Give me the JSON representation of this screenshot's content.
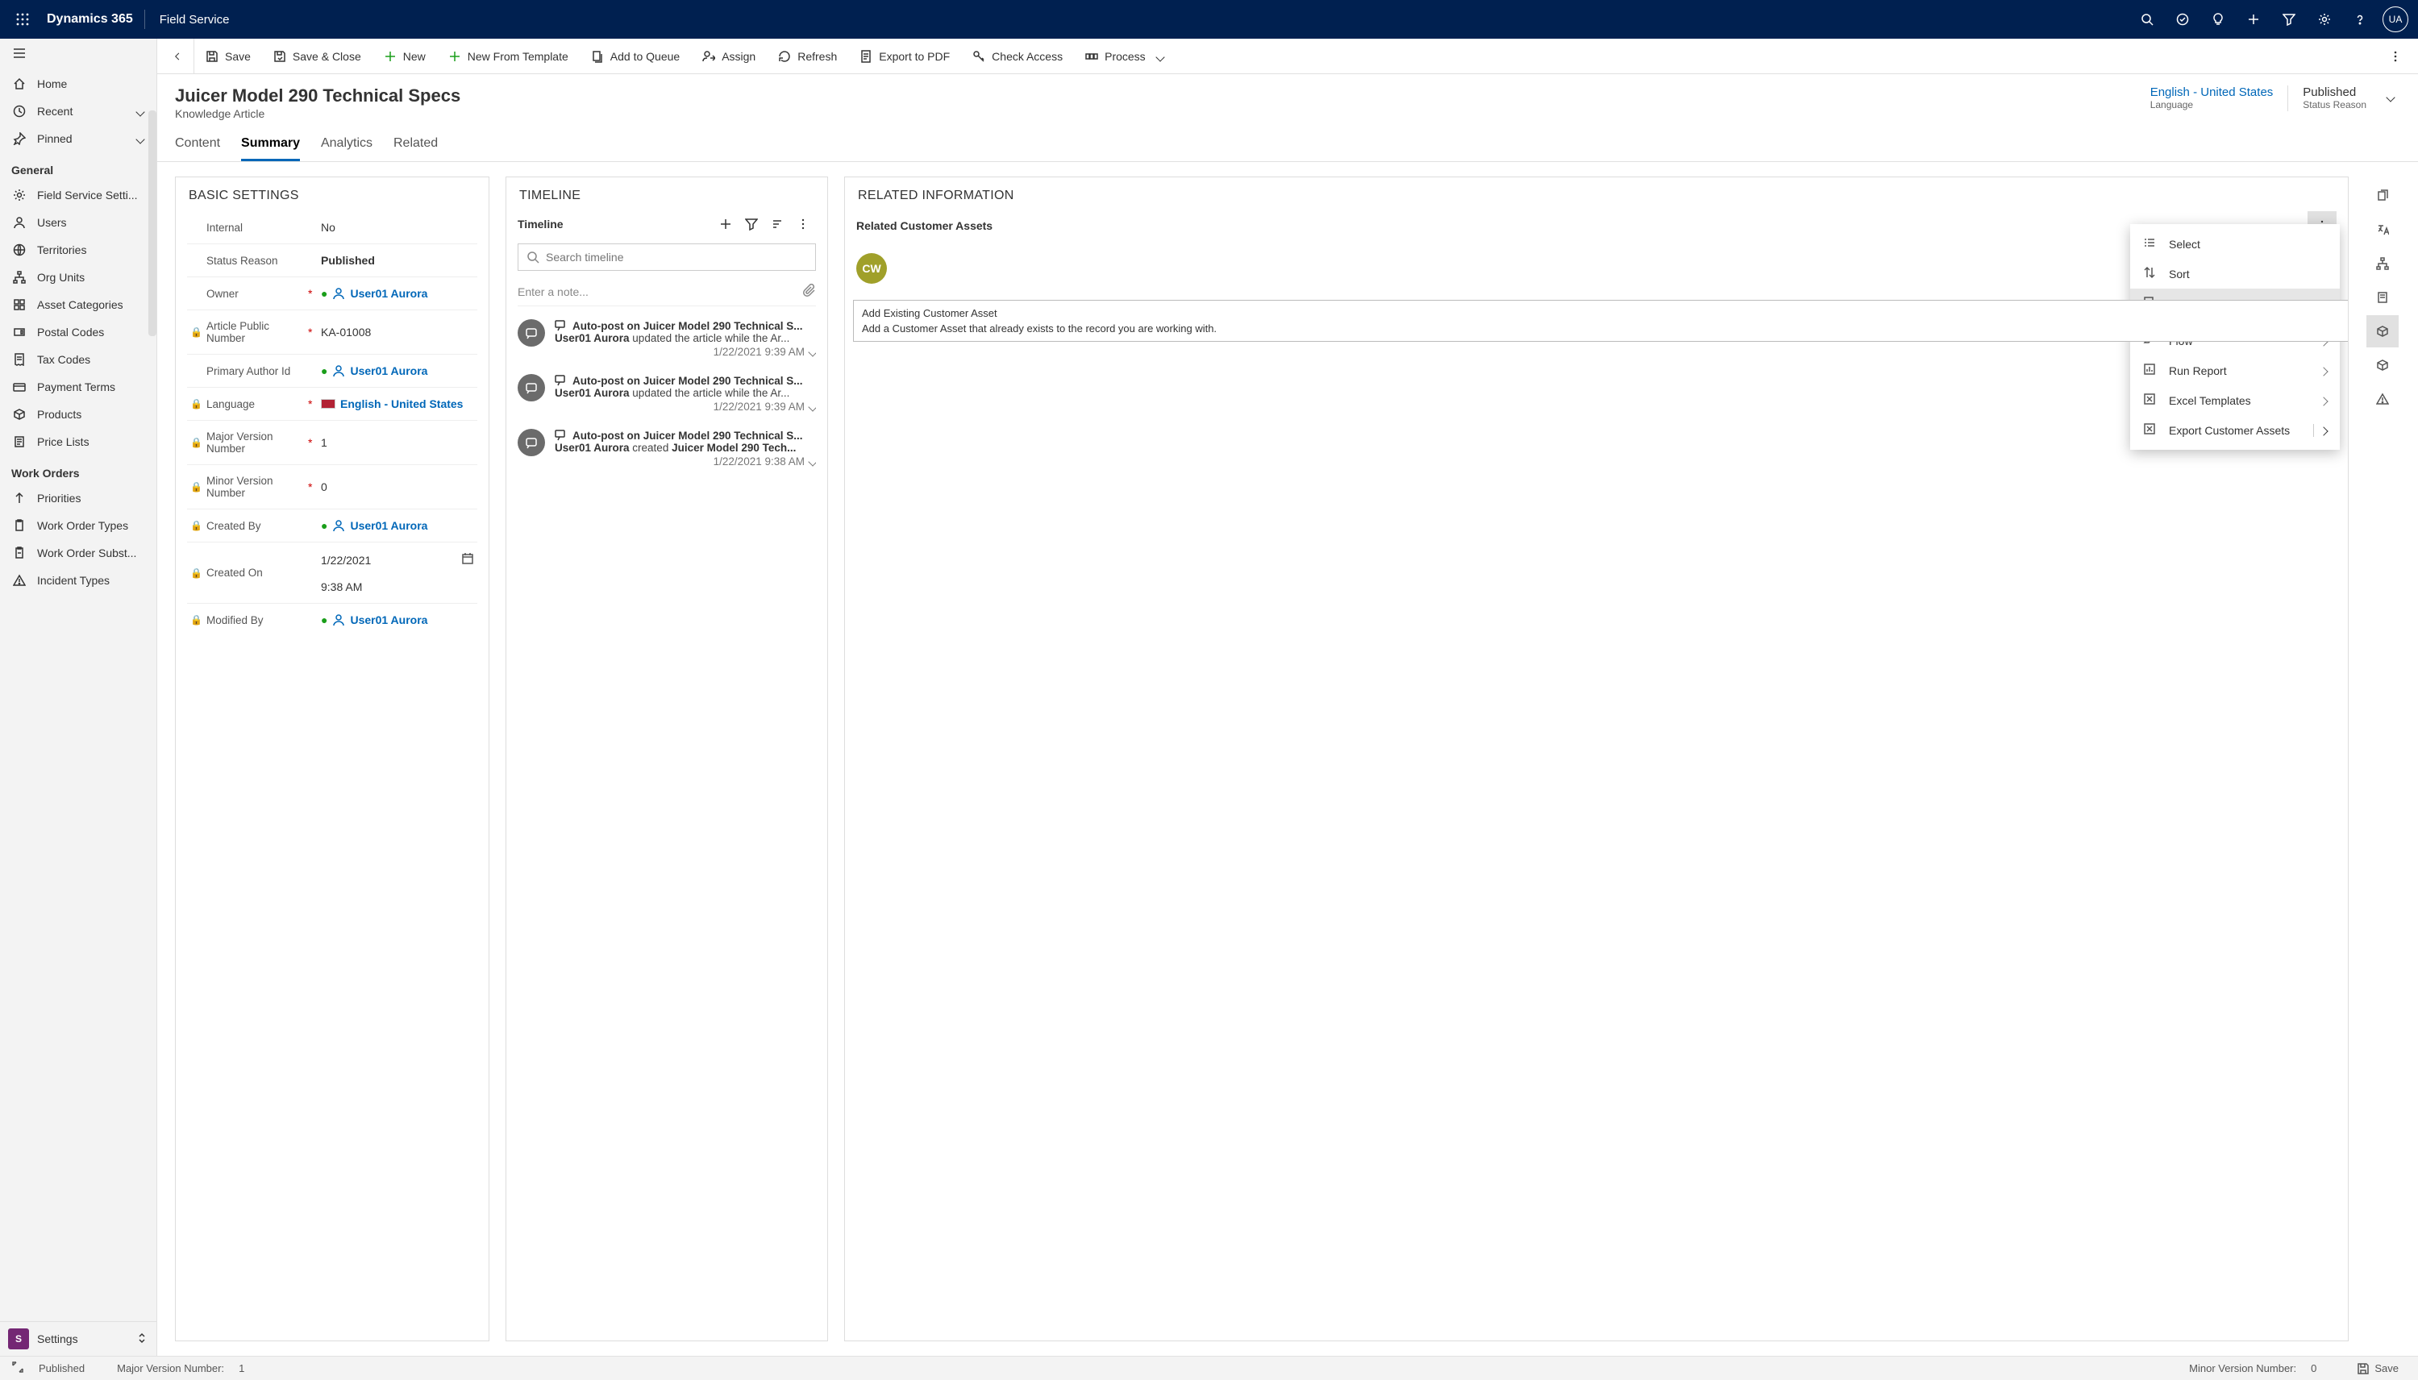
{
  "header": {
    "brand": "Dynamics 365",
    "module": "Field Service",
    "avatar": "UA"
  },
  "sidebar": {
    "top": [
      {
        "icon": "home",
        "label": "Home"
      },
      {
        "icon": "recent",
        "label": "Recent",
        "chevron": true
      },
      {
        "icon": "pin",
        "label": "Pinned",
        "chevron": true
      }
    ],
    "sections": [
      {
        "title": "General",
        "items": [
          {
            "icon": "gear",
            "label": "Field Service Setti..."
          },
          {
            "icon": "user",
            "label": "Users"
          },
          {
            "icon": "globe",
            "label": "Territories"
          },
          {
            "icon": "org",
            "label": "Org Units"
          },
          {
            "icon": "assetcat",
            "label": "Asset Categories"
          },
          {
            "icon": "postal",
            "label": "Postal Codes"
          },
          {
            "icon": "tax",
            "label": "Tax Codes"
          },
          {
            "icon": "payment",
            "label": "Payment Terms"
          },
          {
            "icon": "product",
            "label": "Products"
          },
          {
            "icon": "pricelist",
            "label": "Price Lists"
          }
        ]
      },
      {
        "title": "Work Orders",
        "items": [
          {
            "icon": "priority",
            "label": "Priorities"
          },
          {
            "icon": "wotype",
            "label": "Work Order Types"
          },
          {
            "icon": "wosub",
            "label": "Work Order Subst..."
          },
          {
            "icon": "incident",
            "label": "Incident Types"
          }
        ]
      }
    ],
    "footer": {
      "badge": "S",
      "label": "Settings"
    }
  },
  "commandbar": [
    {
      "icon": "save",
      "label": "Save"
    },
    {
      "icon": "saveclose",
      "label": "Save & Close"
    },
    {
      "icon": "plus",
      "label": "New"
    },
    {
      "icon": "plus",
      "label": "New From Template"
    },
    {
      "icon": "queue",
      "label": "Add to Queue"
    },
    {
      "icon": "assign",
      "label": "Assign"
    },
    {
      "icon": "refresh",
      "label": "Refresh"
    },
    {
      "icon": "pdf",
      "label": "Export to PDF"
    },
    {
      "icon": "key",
      "label": "Check Access"
    },
    {
      "icon": "process",
      "label": "Process",
      "chevron": true
    }
  ],
  "page": {
    "title": "Juicer Model 290 Technical Specs",
    "subtitle": "Knowledge Article",
    "meta": [
      {
        "value": "English - United States",
        "label": "Language",
        "link": true
      },
      {
        "value": "Published",
        "label": "Status Reason"
      }
    ],
    "tabs": [
      "Content",
      "Summary",
      "Analytics",
      "Related"
    ],
    "active_tab": "Summary"
  },
  "basic": {
    "header": "BASIC SETTINGS",
    "fields": [
      {
        "label": "Internal",
        "value": "No"
      },
      {
        "label": "Status Reason",
        "value": "Published",
        "bold": true
      },
      {
        "label": "Owner",
        "required": true,
        "user": "User01 Aurora"
      },
      {
        "label": "Article Public Number",
        "required": true,
        "locked": true,
        "value": "KA-01008"
      },
      {
        "label": "Primary Author Id",
        "user": "User01 Aurora"
      },
      {
        "label": "Language",
        "required": true,
        "locked": true,
        "lang": "English - United States"
      },
      {
        "label": "Major Version Number",
        "required": true,
        "locked": true,
        "value": "1"
      },
      {
        "label": "Minor Version Number",
        "required": true,
        "locked": true,
        "value": "0"
      },
      {
        "label": "Created By",
        "locked": true,
        "user": "User01 Aurora"
      },
      {
        "label": "Created On",
        "locked": true,
        "value": "1/22/2021",
        "value2": "9:38 AM",
        "date": true
      },
      {
        "label": "Modified By",
        "locked": true,
        "user": "User01 Aurora"
      }
    ]
  },
  "timeline": {
    "header": "TIMELINE",
    "label": "Timeline",
    "search_placeholder": "Search timeline",
    "note_placeholder": "Enter a note...",
    "items": [
      {
        "title": "Auto-post on Juicer Model 290 Technical S...",
        "user": "User01 Aurora",
        "action": " updated the article while the Ar...",
        "time": "1/22/2021 9:39 AM"
      },
      {
        "title": "Auto-post on Juicer Model 290 Technical S...",
        "user": "User01 Aurora",
        "action": " updated the article while the Ar...",
        "time": "1/22/2021 9:39 AM"
      },
      {
        "title": "Auto-post on Juicer Model 290 Technical S...",
        "user": "User01 Aurora",
        "action": " created ",
        "bold_suffix": "Juicer Model 290 Tech...",
        "time": "1/22/2021 9:38 AM"
      }
    ]
  },
  "related": {
    "header": "RELATED INFORMATION",
    "subheader": "Related Customer Assets",
    "asset_initials": "CW",
    "menu": [
      {
        "icon": "select",
        "label": "Select"
      },
      {
        "icon": "sort",
        "label": "Sort"
      },
      {
        "icon": "addexist",
        "label": "Add Existing Customer Asset",
        "active": true
      },
      {
        "icon": "flow",
        "label": "Flow",
        "chevron": true
      },
      {
        "icon": "report",
        "label": "Run Report",
        "chevron": true
      },
      {
        "icon": "excel",
        "label": "Excel Templates",
        "chevron": true
      },
      {
        "icon": "export",
        "label": "Export Customer Assets",
        "chevron": true,
        "split": true
      }
    ],
    "tooltip": {
      "title": "Add Existing Customer Asset",
      "body": "Add a Customer Asset that already exists to the record you are working with."
    }
  },
  "statusbar": {
    "status": "Published",
    "major_label": "Major Version Number:",
    "major_value": "1",
    "minor_label": "Minor Version Number:",
    "minor_value": "0",
    "save": "Save"
  }
}
